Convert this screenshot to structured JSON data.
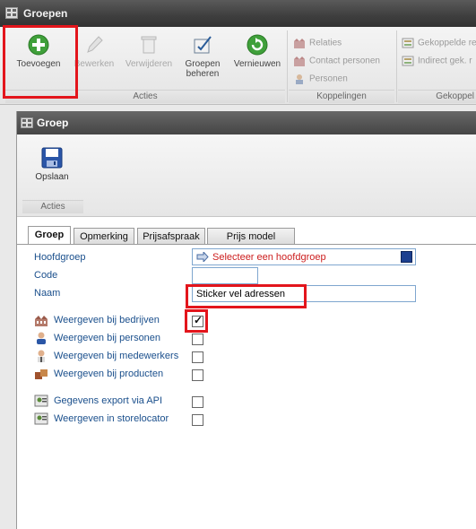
{
  "window": {
    "title": "Groepen"
  },
  "ribbon": {
    "acties": {
      "label": "Acties",
      "buttons": [
        {
          "label": "Toevoegen",
          "icon": "add-icon",
          "enabled": true
        },
        {
          "label": "Bewerken",
          "icon": "edit-icon",
          "enabled": false
        },
        {
          "label": "Verwijderen",
          "icon": "delete-icon",
          "enabled": false
        },
        {
          "label": "Groepen beheren",
          "icon": "manage-groups-icon",
          "enabled": true
        },
        {
          "label": "Vernieuwen",
          "icon": "refresh-icon",
          "enabled": true
        }
      ]
    },
    "koppelingen": {
      "label": "Koppelingen",
      "items": [
        {
          "label": "Relaties",
          "icon": "relations-icon"
        },
        {
          "label": "Contact personen",
          "icon": "contacts-icon"
        },
        {
          "label": "Personen",
          "icon": "person-icon"
        }
      ]
    },
    "gekoppeld": {
      "label": "Gekoppel",
      "items": [
        {
          "label": "Gekoppelde re",
          "icon": "linked-icon"
        },
        {
          "label": "Indirect gek. r",
          "icon": "indirect-linked-icon"
        }
      ]
    }
  },
  "dialog": {
    "title": "Groep",
    "save_label": "Opslaan",
    "acties_label": "Acties",
    "tabs": [
      {
        "label": "Groep",
        "active": true
      },
      {
        "label": "Opmerking",
        "active": false
      },
      {
        "label": "Prijsafspraak",
        "active": false
      },
      {
        "label": "Prijs model",
        "active": false
      }
    ],
    "fields": {
      "hoofdgroep_label": "Hoofdgroep",
      "hoofdgroep_value": "Selecteer een hoofdgroep",
      "code_label": "Code",
      "code_value": "",
      "naam_label": "Naam",
      "naam_value": "Sticker vel adressen"
    },
    "options": [
      {
        "label": "Weergeven bij bedrijven",
        "icon": "company-icon",
        "checked": true
      },
      {
        "label": "Weergeven bij personen",
        "icon": "person-icon",
        "checked": false
      },
      {
        "label": "Weergeven bij medewerkers",
        "icon": "employee-icon",
        "checked": false
      },
      {
        "label": "Weergeven bij producten",
        "icon": "products-icon",
        "checked": false
      },
      {
        "label": "Gegevens export via API",
        "icon": "api-export-icon",
        "checked": false
      },
      {
        "label": "Weergeven in storelocator",
        "icon": "storelocator-icon",
        "checked": false
      }
    ]
  },
  "colors": {
    "highlight": "#e3151c",
    "link": "#1a4f8c",
    "placeholder_red": "#cc1d1d"
  }
}
